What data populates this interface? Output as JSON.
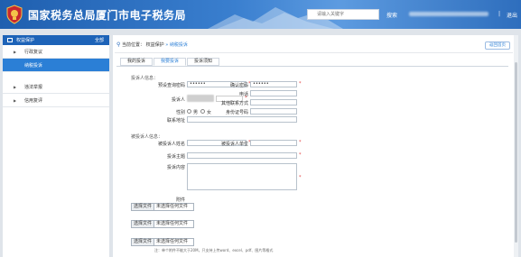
{
  "header": {
    "site_title": "国家税务总局厦门市电子税务局",
    "search_placeholder": "请输入关键字",
    "search_label": "搜索",
    "separator": "|",
    "logout_label": "退出"
  },
  "sidebar": {
    "header_label": "权益保护",
    "header_right": "全部",
    "items": [
      {
        "label": "行政复议",
        "arrow": "▶"
      },
      {
        "label": "纳税投诉",
        "arrow": ""
      },
      {
        "label": "违法举报",
        "arrow": "▶"
      },
      {
        "label": "信用复评",
        "arrow": "▶"
      }
    ]
  },
  "main": {
    "breadcrumb": {
      "prefix": "当前位置：",
      "parent": "权益保护",
      "sep": "»",
      "current": "纳税投诉"
    },
    "back_button": "返回首页",
    "tabs": [
      {
        "label": "我的投诉",
        "active": false
      },
      {
        "label": "我要投诉",
        "active": true
      },
      {
        "label": "投诉须知",
        "active": false
      }
    ],
    "complainant_section": "投诉人信息：",
    "complainant": {
      "password_label": "预设查询密码",
      "password_value": "••••••",
      "confirm_label": "确认密码",
      "confirm_value": "••••••",
      "phone_label": "电话",
      "name_label": "投诉人",
      "other_contact_label": "其他联系方式",
      "id_label": "身份证号码",
      "gender_label": "性别",
      "male": "男",
      "female": "女",
      "address_label": "联系地址"
    },
    "respondent_section": "被投诉人信息：",
    "respondent": {
      "name_label": "被投诉人姓名",
      "unit_label": "被投诉人单位",
      "subject_label": "投诉主题",
      "content_label": "投诉内容"
    },
    "attachment_label": "附件",
    "file_button": "选择文件",
    "file_none": "未选择任何文件",
    "note_text": "注：单个附件不能大于20M，只支持上传word、excel、pdf、图片等格式"
  },
  "colors": {
    "header_blue": "#1f5faf",
    "sidebar_active": "#2b7fd6",
    "required": "#e23b3b"
  }
}
